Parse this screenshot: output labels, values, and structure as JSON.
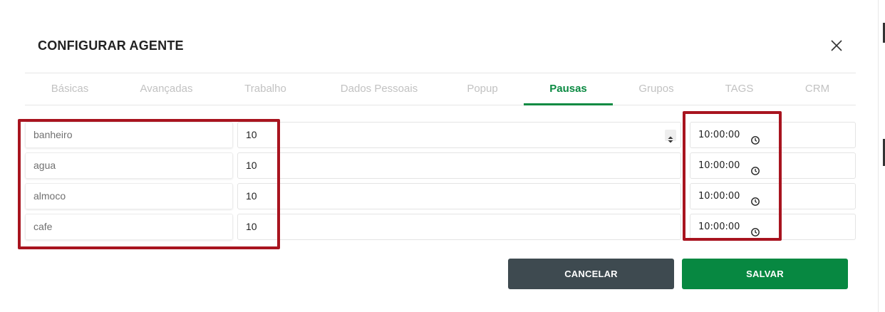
{
  "modal": {
    "title": "CONFIGURAR AGENTE",
    "close_icon": "close-icon"
  },
  "tabs": [
    {
      "label": "Básicas",
      "active": false
    },
    {
      "label": "Avançadas",
      "active": false
    },
    {
      "label": "Trabalho",
      "active": false
    },
    {
      "label": "Dados Pessoais",
      "active": false
    },
    {
      "label": "Popup",
      "active": false
    },
    {
      "label": "Pausas",
      "active": true
    },
    {
      "label": "Grupos",
      "active": false
    },
    {
      "label": "TAGS",
      "active": false
    },
    {
      "label": "CRM",
      "active": false
    }
  ],
  "pauses": [
    {
      "name": "banheiro",
      "count": "10",
      "time": "10:00:00"
    },
    {
      "name": "agua",
      "count": "10",
      "time": "10:00:00"
    },
    {
      "name": "almoco",
      "count": "10",
      "time": "10:00:00"
    },
    {
      "name": "cafe",
      "count": "10",
      "time": "10:00:00"
    }
  ],
  "buttons": {
    "cancel": "CANCELAR",
    "save": "SALVAR"
  },
  "colors": {
    "accent": "#0b8a42",
    "highlight": "#a8141f",
    "cancel_bg": "#3e4a50",
    "save_bg": "#078841"
  }
}
